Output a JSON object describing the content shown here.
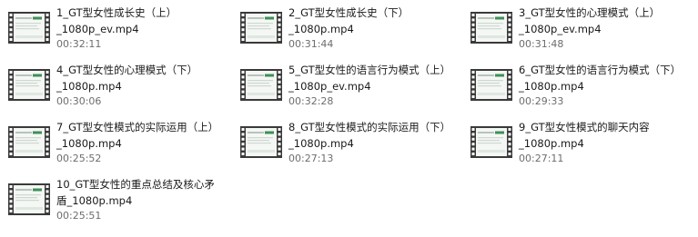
{
  "files": [
    {
      "name_line1": "1_GT型女性成长史（上）",
      "name_line2": "_1080p_ev.mp4",
      "duration": "00:32:11"
    },
    {
      "name_line1": "2_GT型女性成长史（下）",
      "name_line2": "_1080p.mp4",
      "duration": "00:31:44"
    },
    {
      "name_line1": "3_GT型女性的心理模式（上）",
      "name_line2": "_1080p_ev.mp4",
      "duration": "00:31:48"
    },
    {
      "name_line1": "4_GT型女性的心理模式（下）",
      "name_line2": "_1080p.mp4",
      "duration": "00:30:06"
    },
    {
      "name_line1": "5_GT型女性的语言行为模式（上）",
      "name_line2": "_1080p_ev.mp4",
      "duration": "00:32:28"
    },
    {
      "name_line1": "6_GT型女性的语言行为模式（下）",
      "name_line2": "_1080p.mp4",
      "duration": "00:29:33"
    },
    {
      "name_line1": "7_GT型女性模式的实际运用（上）",
      "name_line2": "_1080p.mp4",
      "duration": "00:25:52"
    },
    {
      "name_line1": "8_GT型女性模式的实际运用（下）",
      "name_line2": "_1080p.mp4",
      "duration": "00:27:13"
    },
    {
      "name_line1": "9_GT型女性模式的聊天内容",
      "name_line2": "_1080p.mp4",
      "duration": "00:27:11"
    },
    {
      "name_line1": "10_GT型女性的重点总结及核心矛",
      "name_line2": "盾_1080p.mp4",
      "duration": "00:25:51"
    }
  ],
  "icons": {
    "thumbnail": "video-file-thumbnail-icon"
  },
  "colors": {
    "filmstrip_dark": "#3a3a3a",
    "slide_bg": "#f4f7f4",
    "slide_accent": "#3f8f57",
    "duration_text": "#6d6d6d"
  }
}
